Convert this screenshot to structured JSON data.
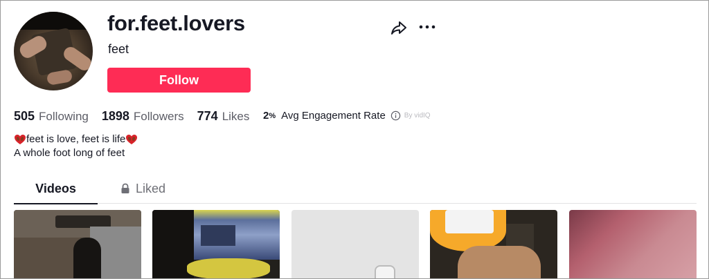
{
  "profile": {
    "username": "for.feet.lovers",
    "nickname": "feet",
    "follow_label": "Follow"
  },
  "stats": {
    "following_count": "505",
    "following_label": "Following",
    "followers_count": "1898",
    "followers_label": "Followers",
    "likes_count": "774",
    "likes_label": "Likes"
  },
  "engagement": {
    "value": "2",
    "unit": "%",
    "label": "Avg Engagement Rate",
    "source": "By vidIQ"
  },
  "bio": {
    "line1": "feet is love, feet is life",
    "line2": "A whole foot long of feet"
  },
  "tabs": [
    {
      "label": "Videos",
      "active": true
    },
    {
      "label": "Liked",
      "active": false,
      "icon": "lock-icon"
    }
  ],
  "icons": {
    "share": "share-icon",
    "more": "more-icon",
    "info": "info-icon",
    "emoji": "red-heart-with-feet-icon"
  },
  "colors": {
    "follow_button": "#fe2c55",
    "text_primary": "#161823",
    "text_secondary": "#5c5d66"
  },
  "videos": [
    {
      "id": "video-1"
    },
    {
      "id": "video-2"
    },
    {
      "id": "video-3"
    },
    {
      "id": "video-4"
    },
    {
      "id": "video-5"
    }
  ]
}
